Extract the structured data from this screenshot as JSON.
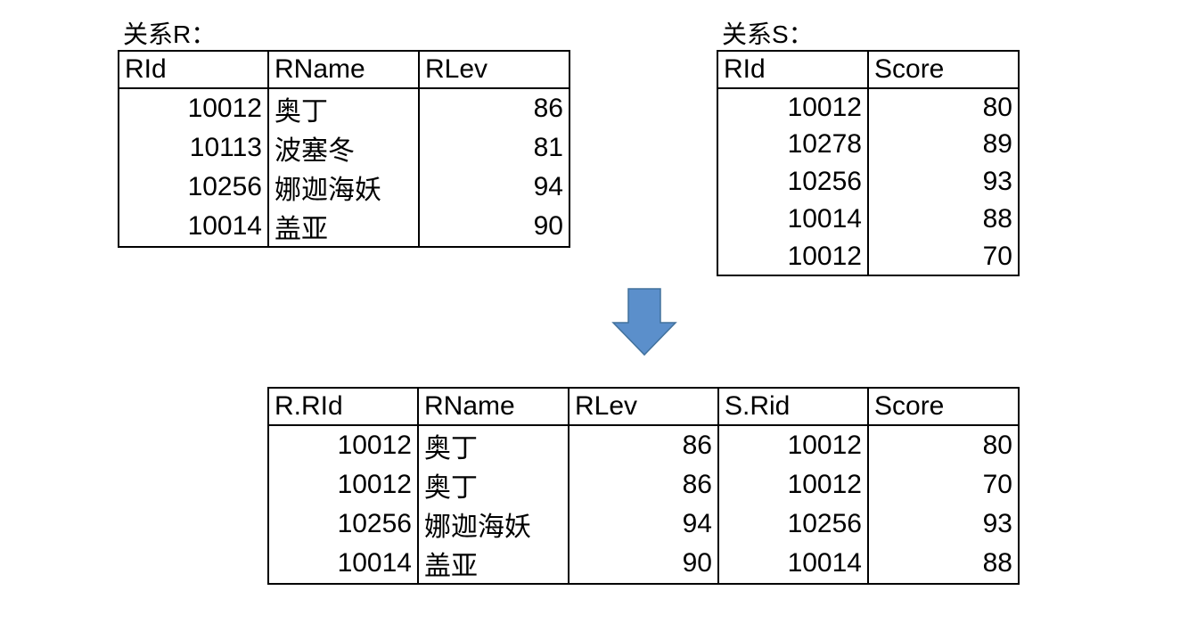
{
  "relation_r": {
    "caption": "关系R：",
    "headers": [
      "RId",
      "RName",
      "RLev"
    ],
    "rows": [
      [
        "10012",
        "奥丁",
        "86"
      ],
      [
        "10113",
        "波塞冬",
        "81"
      ],
      [
        "10256",
        "娜迦海妖",
        "94"
      ],
      [
        "10014",
        "盖亚",
        "90"
      ]
    ]
  },
  "relation_s": {
    "caption": "关系S：",
    "headers": [
      "RId",
      "Score"
    ],
    "rows": [
      [
        "10012",
        "80"
      ],
      [
        "10278",
        "89"
      ],
      [
        "10256",
        "93"
      ],
      [
        "10014",
        "88"
      ],
      [
        "10012",
        "70"
      ]
    ]
  },
  "result": {
    "headers": [
      "R.RId",
      "RName",
      "RLev",
      "S.Rid",
      "Score"
    ],
    "rows": [
      [
        "10012",
        "奥丁",
        "86",
        "10012",
        "80"
      ],
      [
        "10012",
        "奥丁",
        "86",
        "10012",
        "70"
      ],
      [
        "10256",
        "娜迦海妖",
        "94",
        "10256",
        "93"
      ],
      [
        "10014",
        "盖亚",
        "90",
        "10014",
        "88"
      ]
    ]
  },
  "arrow": {
    "icon": "down-arrow-icon",
    "fill": "#5b8fcb",
    "stroke": "#41719c"
  }
}
